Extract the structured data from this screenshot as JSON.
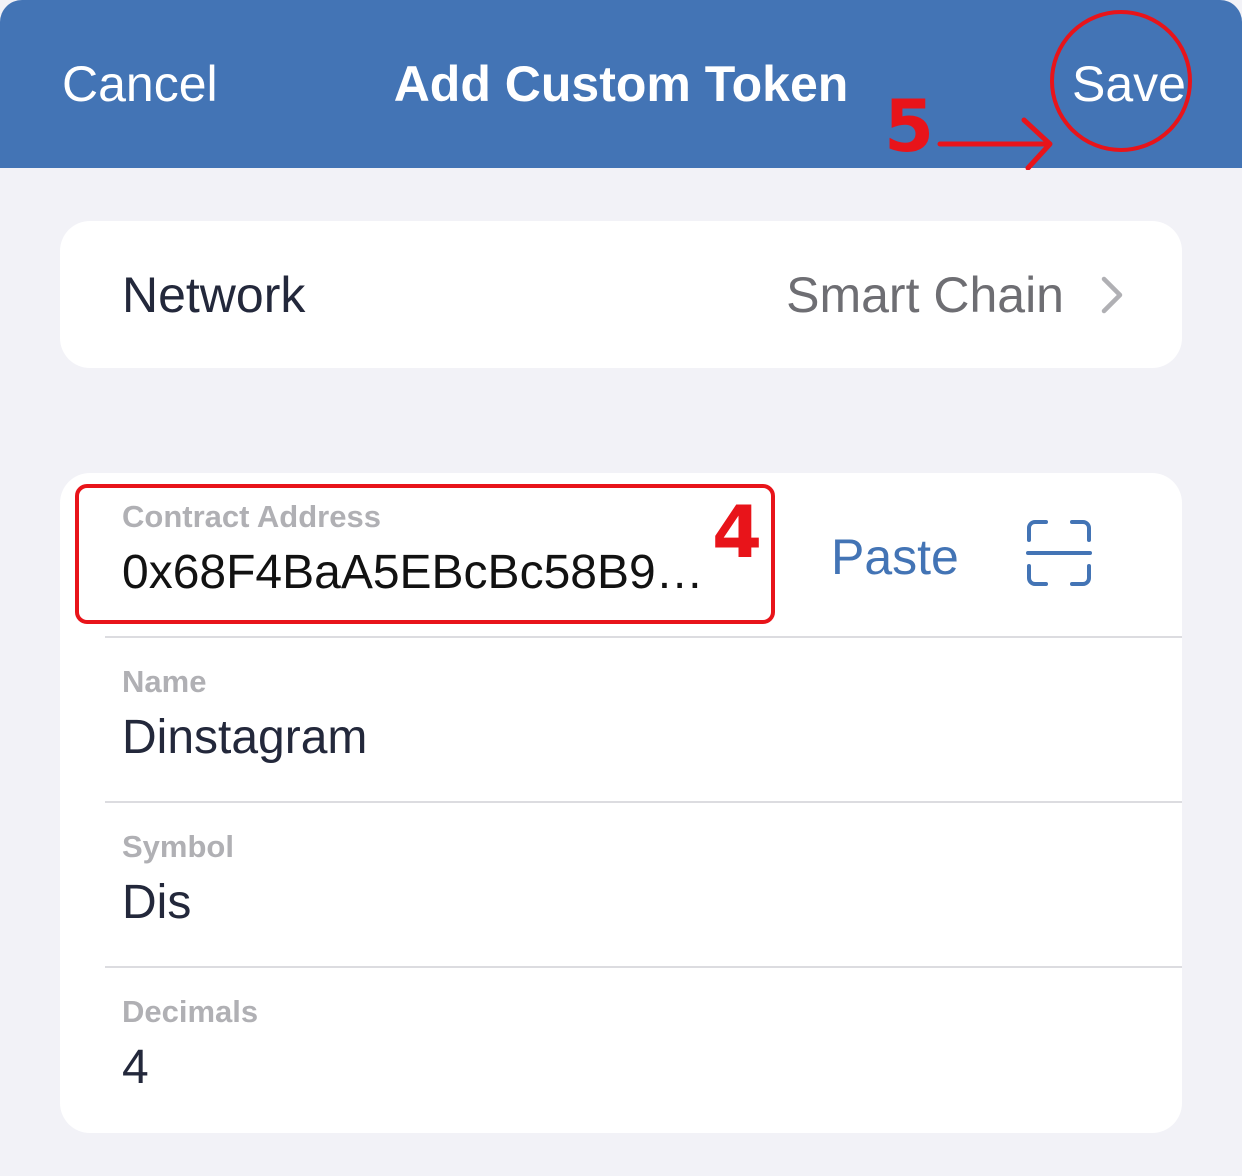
{
  "navbar": {
    "cancel_label": "Cancel",
    "title": "Add Custom Token",
    "save_label": "Save",
    "background_color": "#4374b5"
  },
  "annotations": {
    "step_save": "5",
    "step_contract": "4",
    "color": "#e8141a"
  },
  "network": {
    "label": "Network",
    "value": "Smart Chain",
    "chevron_icon": "chevron-right-icon"
  },
  "form": {
    "contract_address": {
      "label": "Contract Address",
      "value": "0x68F4BaA5EBcBc58B9…",
      "paste_label": "Paste",
      "scan_icon": "qr-scan-icon"
    },
    "name": {
      "label": "Name",
      "value": "Dinstagram"
    },
    "symbol": {
      "label": "Symbol",
      "value": "Dis"
    },
    "decimals": {
      "label": "Decimals",
      "value": "4"
    }
  }
}
